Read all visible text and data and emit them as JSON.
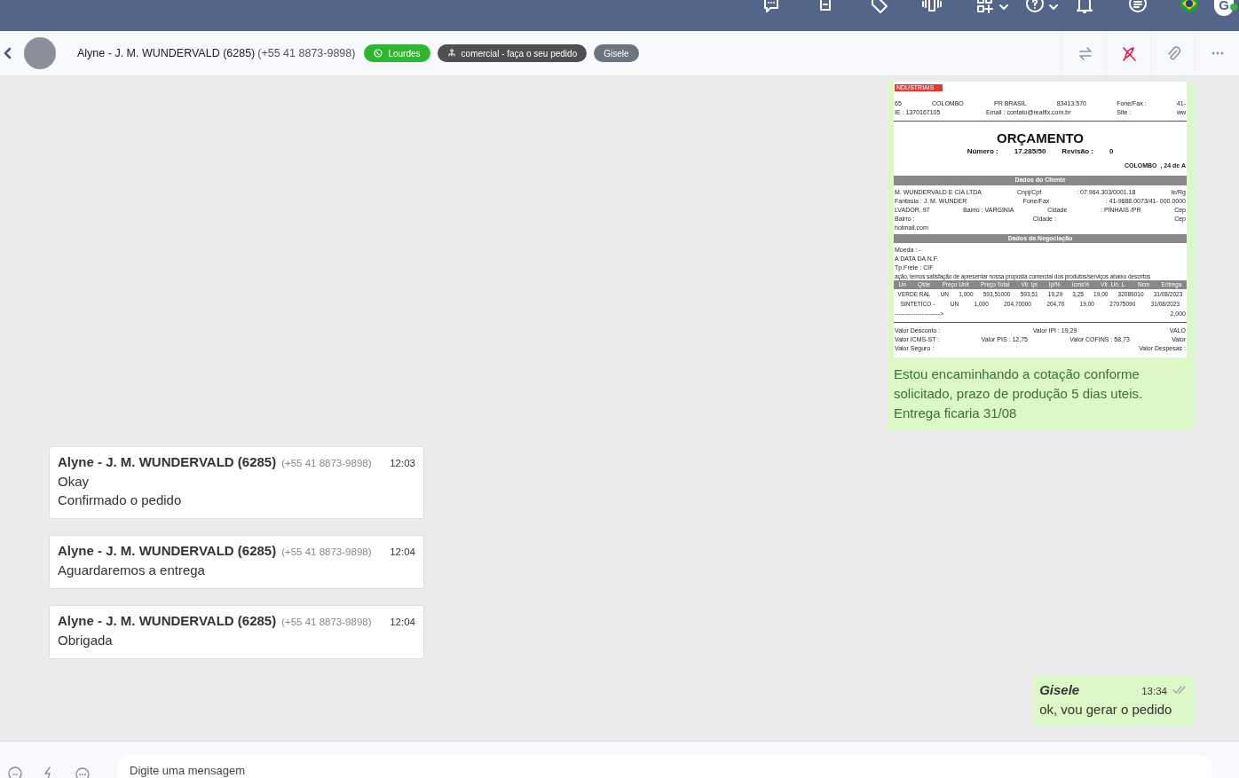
{
  "top_bar": {
    "avatar_letter": "G"
  },
  "header": {
    "contact_name": "Alyne - J. M. WUNDERVALD (6285)",
    "contact_phone": "(+55 41 8873-9898)",
    "tags": [
      {
        "kind": "whatsapp",
        "label": "Lourdes",
        "color": "#2fb52f"
      },
      {
        "kind": "queue",
        "label": "comercial - faça o seu pedido",
        "color": "#4f4f4f"
      },
      {
        "kind": "user",
        "label": "Gisele",
        "color": "#6c757d"
      }
    ]
  },
  "messages": [
    {
      "outgoing": true,
      "kind": "document",
      "document": {
        "lines": [
          {
            "kind": "logo",
            "cells": [
              "NDUSTRIAIS"
            ]
          },
          {
            "kind": "row",
            "cells": [
              "65",
              "COLOMBO",
              "PR   BRASIL",
              "83413.570",
              "Fone/Fax :",
              "41-"
            ]
          },
          {
            "kind": "row",
            "cells": [
              "IE :   1370167105",
              "Email :   contato@realfix.com.br",
              "Site :",
              "ww"
            ]
          },
          {
            "kind": "rule"
          },
          {
            "kind": "title",
            "cells": [
              "ORÇAMENTO"
            ]
          },
          {
            "kind": "meta",
            "cells": [
              "Número :",
              "17.285/50",
              "Revisão :",
              "0"
            ]
          },
          {
            "kind": "right",
            "cells": [
              "COLOMBO",
              ", 24 de A"
            ]
          },
          {
            "kind": "section",
            "cells": [
              "Dados do Cliente"
            ]
          },
          {
            "kind": "row",
            "cells": [
              "M. WUNDERVALD E CIA LTDA",
              "Cnpj/Cpf",
              ":  07.964.303/0001.18",
              "Ie/Rg"
            ]
          },
          {
            "kind": "row",
            "cells": [
              "Fantasia  :  J. M. WUNDER",
              "Fone/Fax",
              ":  41-9888.0073/41- 000.0000"
            ]
          },
          {
            "kind": "row",
            "cells": [
              "LVADOR, 97",
              "Bairro  :  VARGINIA",
              "Cidade",
              ":  PINHAIS     /PR",
              "Cep"
            ]
          },
          {
            "kind": "row",
            "cells": [
              "Bairro  :",
              "Cidade  :",
              "Cep"
            ]
          },
          {
            "kind": "row",
            "cells": [
              "hotmail.com"
            ]
          },
          {
            "kind": "section",
            "cells": [
              "Dados da Negociação"
            ]
          },
          {
            "kind": "row",
            "cells": [
              "Moeda  :  -"
            ]
          },
          {
            "kind": "row",
            "cells": [
              "A DATA DA N.F."
            ]
          },
          {
            "kind": "row",
            "cells": [
              "Tp.Frete  :  CIF"
            ]
          },
          {
            "kind": "row",
            "cells": [
              "ação, temos satisfação de apresentar nossa proposta comercial dos produtos/serviços abaixo descritos"
            ]
          },
          {
            "kind": "table_head",
            "cells": [
              "Un",
              "Qtde",
              "Preço Unit",
              "Preço Total",
              "Vlr. Ipi",
              "Ipi%",
              "Icms%",
              "Vlr. Un. L.",
              "Ncm",
              "Entrega"
            ]
          },
          {
            "kind": "table_row",
            "cells": [
              "VERDE RAL",
              "UN",
              "1,000",
              "593,51000",
              "593,51",
              "19,29",
              "3,25",
              "19,00",
              "32089010",
              "31/08/2023"
            ]
          },
          {
            "kind": "table_row",
            "cells": [
              "SINTETICO -",
              "UN",
              "1,000",
              "204,70000",
              "204,70",
              "19,00",
              "27075090",
              "31/08/2023"
            ]
          },
          {
            "kind": "row",
            "cells": [
              "---------------------->",
              "2,000"
            ]
          },
          {
            "kind": "rule"
          },
          {
            "kind": "row",
            "cells": [
              "Valor Desconto  :",
              "Valor IPI  :  19,29",
              "VALO"
            ]
          },
          {
            "kind": "row",
            "cells": [
              "Valor ICMS-ST  :",
              "Valor PIS  :  12,75",
              "Valor COFINS  :  58,73",
              "Valor"
            ]
          },
          {
            "kind": "row",
            "cells": [
              "Valor Seguro  :",
              "Valor Despesas  :"
            ]
          }
        ]
      },
      "text": "Estou encaminhando a cotação conforme solicitado, prazo de produção 5 dias uteis. Entrega ficaria 31/08"
    },
    {
      "outgoing": false,
      "kind": "text",
      "sender": "Alyne - J. M. WUNDERVALD (6285)",
      "phone": "(+55 41 8873-9898)",
      "time": "12:03",
      "lines": [
        "Okay",
        "Confirmado o pedido"
      ]
    },
    {
      "outgoing": false,
      "kind": "text",
      "sender": "Alyne - J. M. WUNDERVALD (6285)",
      "phone": "(+55 41 8873-9898)",
      "time": "12:04",
      "lines": [
        "Aguardaremos a entrega"
      ]
    },
    {
      "outgoing": false,
      "kind": "text",
      "sender": "Alyne - J. M. WUNDERVALD (6285)",
      "phone": "(+55 41 8873-9898)",
      "time": "12:04",
      "lines": [
        "Obrigada"
      ]
    },
    {
      "outgoing": true,
      "kind": "text",
      "sender": "Gisele",
      "time": "13:34",
      "lines": [
        "ok, vou gerar o pedido"
      ]
    }
  ],
  "composer": {
    "placeholder": "Digite uma mensagem"
  }
}
